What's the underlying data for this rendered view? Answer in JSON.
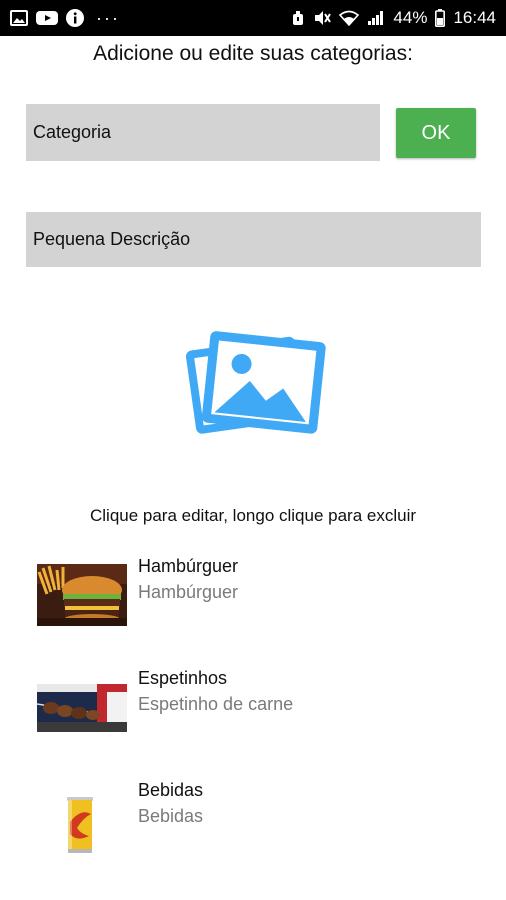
{
  "status_bar": {
    "battery": "44%",
    "time": "16:44",
    "icons": [
      "image-icon",
      "youtube-icon",
      "info-icon",
      "more-dots-icon",
      "alarm-icon",
      "mute-icon",
      "wifi-icon",
      "signal-icon",
      "battery-icon"
    ]
  },
  "header": {
    "title": "Adicione ou edite suas categorias:"
  },
  "form": {
    "category_placeholder": "Categoria",
    "description_placeholder": "Pequena Descrição",
    "ok_label": "OK"
  },
  "image_picker": {
    "icon": "photos-icon",
    "color": "#3fa9f5"
  },
  "list": {
    "hint": "Clique para editar, longo clique para excluir",
    "items": [
      {
        "name": "Hambúrguer",
        "description": "Hambúrguer"
      },
      {
        "name": "Espetinhos",
        "description": "Espetinho de  carne"
      },
      {
        "name": "Bebidas",
        "description": "Bebidas"
      }
    ]
  },
  "colors": {
    "ok_button": "#4caf50",
    "field_bg": "#d3d3d3",
    "status_bar": "#000000",
    "secondary_text": "#7a7a7a"
  }
}
